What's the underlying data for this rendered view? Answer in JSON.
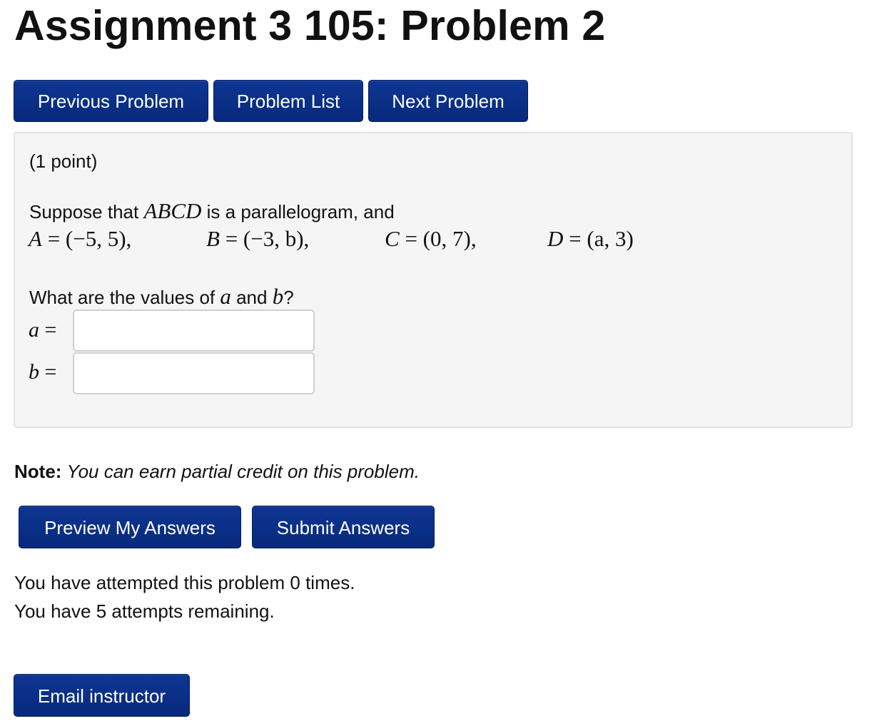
{
  "page": {
    "title": "Assignment 3 105: Problem 2"
  },
  "nav": {
    "previous_label": "Previous Problem",
    "list_label": "Problem List",
    "next_label": "Next Problem"
  },
  "problem": {
    "points": "(1 point)",
    "statement_prefix": "Suppose that ",
    "shape_name": "ABCD",
    "statement_suffix": " is a parallelogram, and",
    "vertices": [
      {
        "name": "A",
        "coords": "(−5, 5),"
      },
      {
        "name": "B",
        "coords": "(−3, b),"
      },
      {
        "name": "C",
        "coords": "(0, 7),"
      },
      {
        "name": "D",
        "coords": "(a, 3)"
      }
    ],
    "question_prefix": "What are the values of ",
    "question_var_a": "a",
    "question_mid": " and ",
    "question_var_b": "b",
    "question_suffix": "?",
    "answers": [
      {
        "var": "a",
        "value": ""
      },
      {
        "var": "b",
        "value": ""
      }
    ]
  },
  "note": {
    "label": "Note:",
    "text": "You can earn partial credit on this problem."
  },
  "actions": {
    "preview_label": "Preview My Answers",
    "submit_label": "Submit Answers"
  },
  "status": {
    "attempts_made": "You have attempted this problem 0 times.",
    "attempts_remaining": "You have 5 attempts remaining."
  },
  "footer": {
    "email_label": "Email instructor"
  },
  "colors": {
    "button_bg": "#0b2f8a",
    "button_text": "#ffffff",
    "panel_bg": "#f5f5f5",
    "panel_border": "#e2e2e2"
  }
}
